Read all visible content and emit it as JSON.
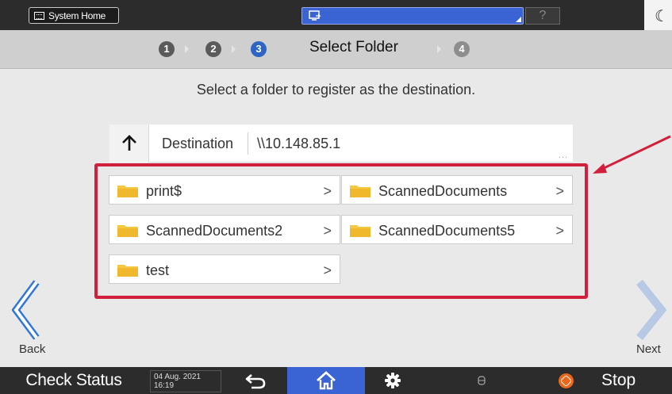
{
  "topbar": {
    "system_home_label": "System Home",
    "help_label": "?"
  },
  "steps": {
    "one": "1",
    "two": "2",
    "three": "3",
    "four": "4",
    "title": "Select Folder"
  },
  "instruction": "Select a folder to register as the destination.",
  "destination": {
    "label": "Destination",
    "path": "\\\\10.148.85.1",
    "more": "..."
  },
  "folders": [
    {
      "name": "print$"
    },
    {
      "name": "ScannedDocuments"
    },
    {
      "name": "ScannedDocuments2"
    },
    {
      "name": "ScannedDocuments5"
    },
    {
      "name": "test"
    }
  ],
  "chevron": ">",
  "nav": {
    "back_label": "Back",
    "next_label": "Next"
  },
  "bottombar": {
    "check_status_label": "Check Status",
    "date": "04 Aug. 2021",
    "time": "16:19",
    "stop_label": "Stop"
  },
  "colors": {
    "accent": "#2e64c6",
    "highlight": "#d21f3c",
    "folder": "#f5c842"
  }
}
